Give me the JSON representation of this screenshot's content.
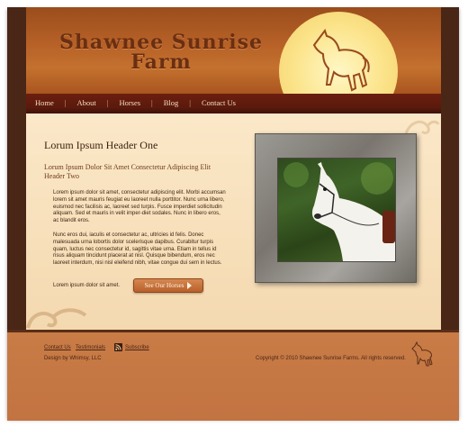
{
  "site": {
    "title_line1": "Shawnee Sunrise",
    "title_line2": "Farm"
  },
  "nav": {
    "items": [
      "Home",
      "About",
      "Horses",
      "Blog",
      "Contact Us"
    ],
    "separator": "|"
  },
  "main": {
    "header_one": "Lorum Ipsum Header One",
    "header_two": "Lorum Ipsum Dolor Sit Amet Consectetur Adipiscing Elit Header Two",
    "paragraph_1": "Lorem ipsum dolor sit amet, consectetur adipiscing elit. Morbi accumsan lorem sit amet mauris feugiat eu laoreet nulla porttitor. Nunc urna libero, euismod nec facilisis ac, laoreet sed turpis. Fusce imperdiet sollicitudin aliquam. Sed et mauris in velit imper-diet sodales. Nunc in libero eros, ac blandit eros.",
    "paragraph_2": "Nunc eros dui, iaculis et consectetur ac, ultricies id felis. Donec malesuada urna lobortis dolor scelerisque dapibus. Curabitur turpis quam, luctus nec consectetur id, sagittis vitae urna. Etiam in tellus id risus aliquam tincidunt placerat at nisl. Quisque bibendum, eros nec laoreet interdum, nisi nisl eleifend nibh, vitae congue dui sem in lectus.",
    "paragraph_3": "Lorem ipsum dolor sit amet.",
    "cta_label": "See Our Horses"
  },
  "footer": {
    "links": [
      "Contact Us",
      "Testimonials",
      "Subscribe"
    ],
    "credit": "Design by Whimsy, LLC",
    "copyright": "Copyright © 2010 Shawnee Sunrise Farms. All rights reserved."
  },
  "icons": {
    "logo": "horse-silhouette-icon",
    "feed": "rss-icon",
    "cta": "arrow-right-icon"
  },
  "colors": {
    "header_orange": "#b86228",
    "sun_yellow": "#fbe389",
    "nav_maroon": "#5a1a0c",
    "content_cream": "#f4d9b0",
    "footer_orange": "#c97c46",
    "frame_brown": "#4a2616"
  }
}
